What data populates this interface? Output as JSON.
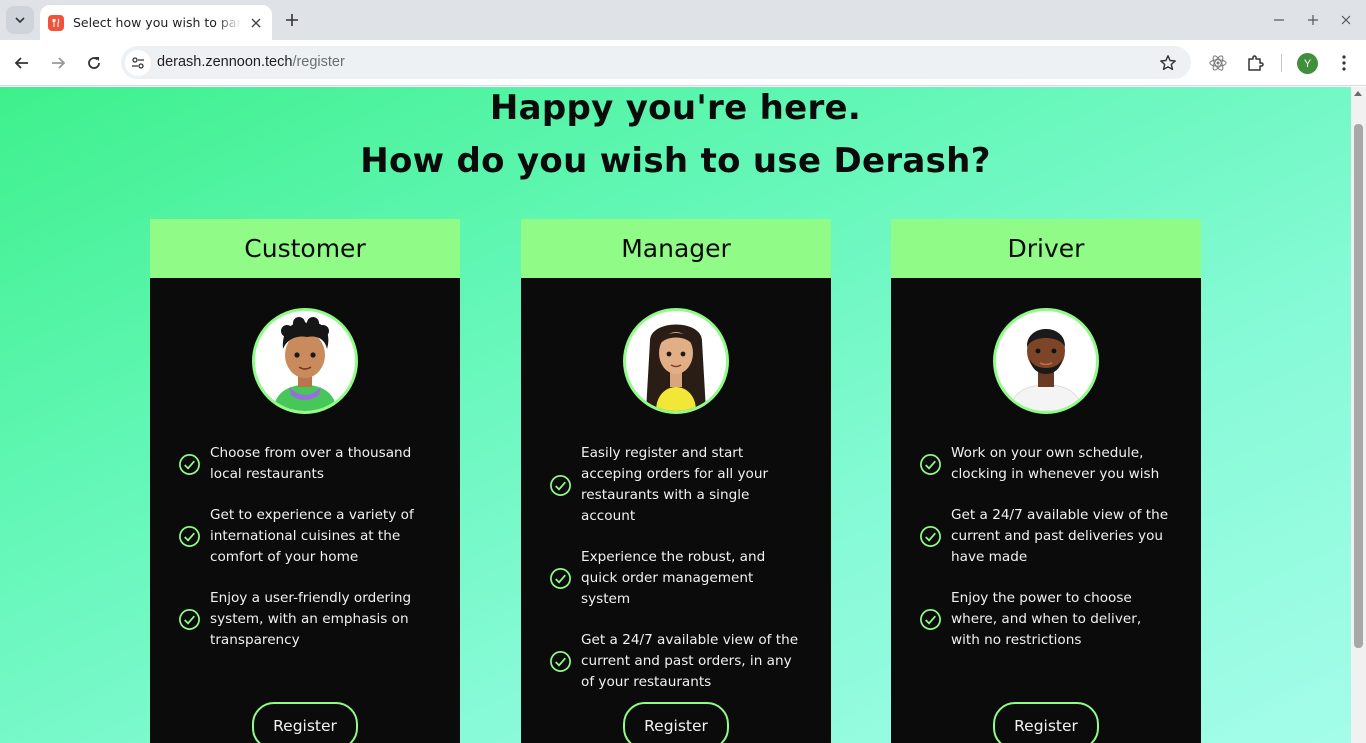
{
  "browser": {
    "tab_title": "Select how you wish to partner with Derash",
    "url_host": "derash.zennoon.tech",
    "url_path": "/register",
    "profile_initial": "Y"
  },
  "page": {
    "heading_line1": "Happy you're here.",
    "heading_line2": "How do you wish to use Derash?",
    "cards": [
      {
        "title": "Customer",
        "features": [
          "Choose from over a thousand local restaurants",
          "Get to experience a variety of international cuisines at the comfort of your home",
          "Enjoy a user-friendly ordering system, with an emphasis on transparency"
        ],
        "button": "Register"
      },
      {
        "title": "Manager",
        "features": [
          "Easily register and start acceping orders for all your restaurants with a single account",
          "Experience the robust, and quick order management system",
          "Get a 24/7 available view of the current and past orders, in any of your restaurants"
        ],
        "button": "Register"
      },
      {
        "title": "Driver",
        "features": [
          "Work on your own schedule, clocking in whenever you wish",
          "Get a 24/7 available view of the current and past deliveries you have made",
          "Enjoy the power to choose where, and when to deliver, with no restrictions"
        ],
        "button": "Register"
      }
    ]
  },
  "colors": {
    "accent": "#90fb86",
    "card_bg": "#0b0b0b",
    "bg_start": "#3ef08c",
    "bg_end": "#a4fde9"
  }
}
